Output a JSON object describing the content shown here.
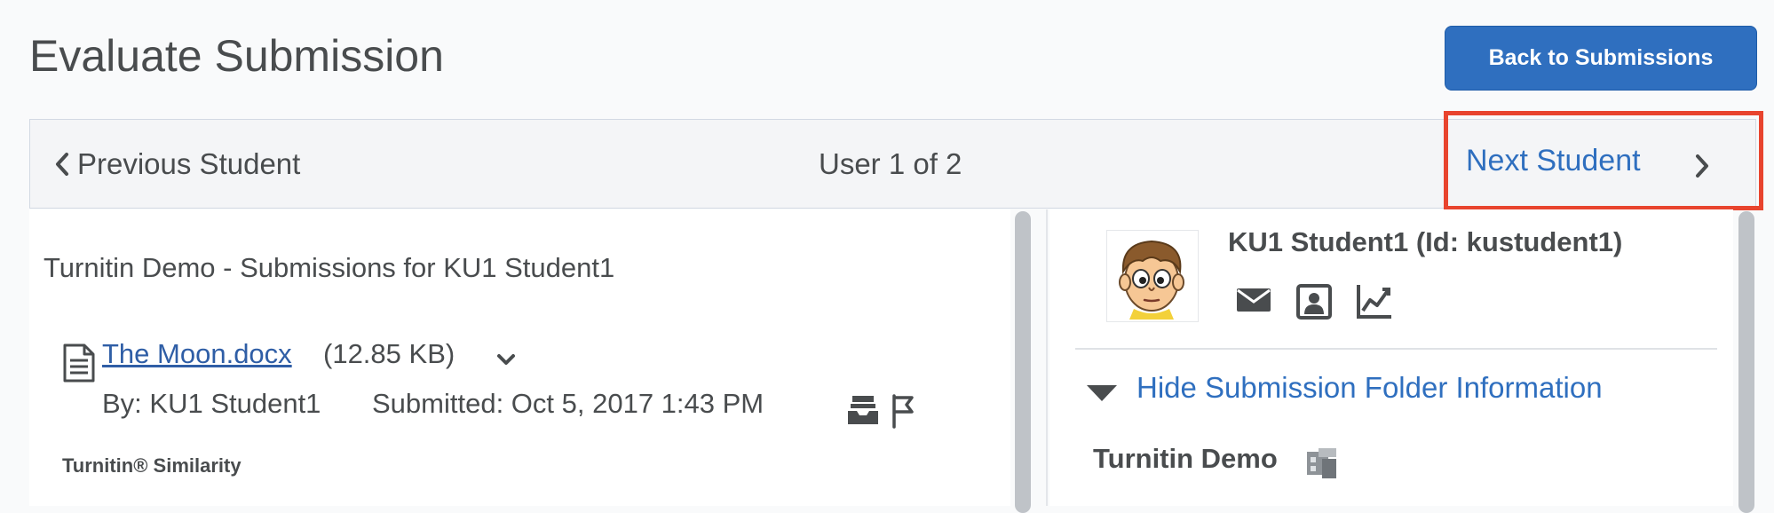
{
  "header": {
    "title": "Evaluate Submission",
    "back_button": "Back to Submissions"
  },
  "navigation": {
    "previous_label": "Previous Student",
    "counter": "User 1 of 2",
    "next_label": "Next Student",
    "highlight_color": "#e8442e"
  },
  "submission": {
    "heading": "Turnitin Demo - Submissions for KU1 Student1",
    "file": {
      "name": "The Moon.docx",
      "size": "(12.85 KB)"
    },
    "by": "By: KU1 Student1",
    "submitted": "Submitted: Oct 5, 2017 1:43 PM",
    "similarity_label": "Turnitin® Similarity"
  },
  "student_panel": {
    "name": "KU1 Student1 (Id: kustudent1)",
    "actions": [
      "mail-icon",
      "user-profile-icon",
      "progress-chart-icon"
    ],
    "toggle_label": "Hide Submission Folder Information",
    "folder_name": "Turnitin Demo"
  },
  "colors": {
    "primary": "#2f6fbf",
    "text": "#494c4e",
    "link": "#2f5ea6"
  }
}
